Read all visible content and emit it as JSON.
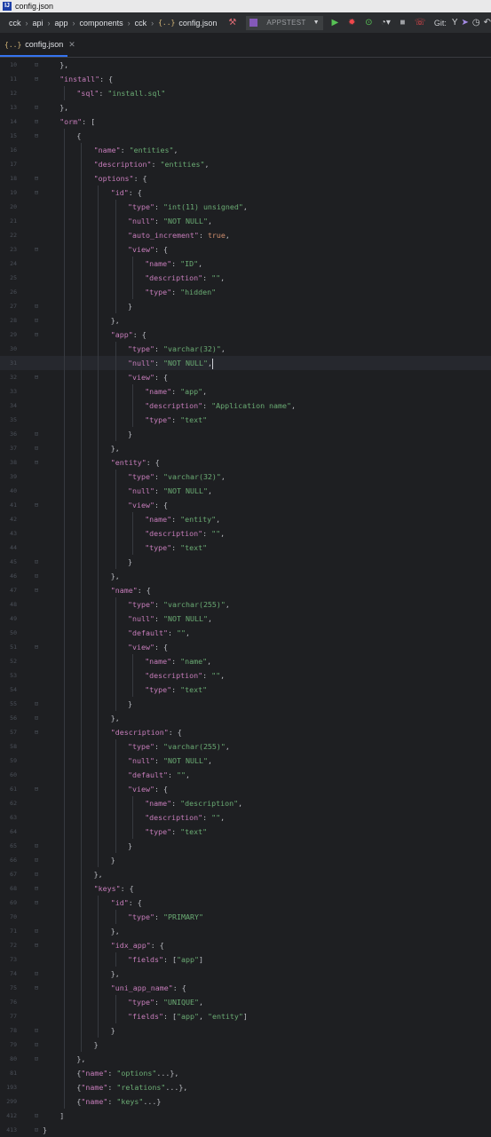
{
  "window": {
    "title": "config.json"
  },
  "navbar": {
    "breadcrumbs": [
      "cck",
      "api",
      "app",
      "components",
      "cck",
      "config.json"
    ],
    "run_config": "APPSTEST",
    "git_label": "Git:"
  },
  "tab": {
    "label": "config.json"
  },
  "colors": {
    "background": "#1e1f22",
    "key": "#c77dbb",
    "string": "#6aab73",
    "keyword": "#cf8e6d",
    "punct": "#bcbec4",
    "accent": "#3574f0"
  },
  "editor": {
    "current_line": 31,
    "lines": [
      {
        "n": "10",
        "indent": 1,
        "tokens": [
          [
            "p",
            "},"
          ]
        ]
      },
      {
        "n": "11",
        "indent": 1,
        "tokens": [
          [
            "k",
            "\"install\""
          ],
          [
            "p",
            ": {"
          ]
        ]
      },
      {
        "n": "12",
        "indent": 2,
        "tokens": [
          [
            "k",
            "\"sql\""
          ],
          [
            "p",
            ": "
          ],
          [
            "s",
            "\"install.sql\""
          ]
        ]
      },
      {
        "n": "13",
        "indent": 1,
        "tokens": [
          [
            "p",
            "},"
          ]
        ]
      },
      {
        "n": "14",
        "indent": 1,
        "tokens": [
          [
            "k",
            "\"orm\""
          ],
          [
            "p",
            ": ["
          ]
        ]
      },
      {
        "n": "15",
        "indent": 2,
        "tokens": [
          [
            "p",
            "{"
          ]
        ]
      },
      {
        "n": "16",
        "indent": 3,
        "tokens": [
          [
            "k",
            "\"name\""
          ],
          [
            "p",
            ": "
          ],
          [
            "s",
            "\"entities\""
          ],
          [
            "p",
            ","
          ]
        ]
      },
      {
        "n": "17",
        "indent": 3,
        "tokens": [
          [
            "k",
            "\"description\""
          ],
          [
            "p",
            ": "
          ],
          [
            "s",
            "\"entities\""
          ],
          [
            "p",
            ","
          ]
        ]
      },
      {
        "n": "18",
        "indent": 3,
        "tokens": [
          [
            "k",
            "\"options\""
          ],
          [
            "p",
            ": {"
          ]
        ]
      },
      {
        "n": "19",
        "indent": 4,
        "tokens": [
          [
            "k",
            "\"id\""
          ],
          [
            "p",
            ": {"
          ]
        ]
      },
      {
        "n": "20",
        "indent": 5,
        "tokens": [
          [
            "k",
            "\"type\""
          ],
          [
            "p",
            ": "
          ],
          [
            "s",
            "\"int(11) unsigned\""
          ],
          [
            "p",
            ","
          ]
        ]
      },
      {
        "n": "21",
        "indent": 5,
        "tokens": [
          [
            "k",
            "\"null\""
          ],
          [
            "p",
            ": "
          ],
          [
            "s",
            "\"NOT NULL\""
          ],
          [
            "p",
            ","
          ]
        ]
      },
      {
        "n": "22",
        "indent": 5,
        "tokens": [
          [
            "k",
            "\"auto_increment\""
          ],
          [
            "p",
            ": "
          ],
          [
            "w",
            "true"
          ],
          [
            "p",
            ","
          ]
        ]
      },
      {
        "n": "23",
        "indent": 5,
        "tokens": [
          [
            "k",
            "\"view\""
          ],
          [
            "p",
            ": {"
          ]
        ]
      },
      {
        "n": "24",
        "indent": 6,
        "tokens": [
          [
            "k",
            "\"name\""
          ],
          [
            "p",
            ": "
          ],
          [
            "s",
            "\"ID\""
          ],
          [
            "p",
            ","
          ]
        ]
      },
      {
        "n": "25",
        "indent": 6,
        "tokens": [
          [
            "k",
            "\"description\""
          ],
          [
            "p",
            ": "
          ],
          [
            "s",
            "\"\""
          ],
          [
            "p",
            ","
          ]
        ]
      },
      {
        "n": "26",
        "indent": 6,
        "tokens": [
          [
            "k",
            "\"type\""
          ],
          [
            "p",
            ": "
          ],
          [
            "s",
            "\"hidden\""
          ]
        ]
      },
      {
        "n": "27",
        "indent": 5,
        "tokens": [
          [
            "p",
            "}"
          ]
        ]
      },
      {
        "n": "28",
        "indent": 4,
        "tokens": [
          [
            "p",
            "},"
          ]
        ]
      },
      {
        "n": "29",
        "indent": 4,
        "tokens": [
          [
            "k",
            "\"app\""
          ],
          [
            "p",
            ": {"
          ]
        ]
      },
      {
        "n": "30",
        "indent": 5,
        "tokens": [
          [
            "k",
            "\"type\""
          ],
          [
            "p",
            ": "
          ],
          [
            "s",
            "\"varchar(32)\""
          ],
          [
            "p",
            ","
          ]
        ]
      },
      {
        "n": "31",
        "indent": 5,
        "tokens": [
          [
            "k",
            "\"null\""
          ],
          [
            "p",
            ": "
          ],
          [
            "s",
            "\"NOT NULL\""
          ],
          [
            "p",
            ","
          ]
        ]
      },
      {
        "n": "32",
        "indent": 5,
        "tokens": [
          [
            "k",
            "\"view\""
          ],
          [
            "p",
            ": {"
          ]
        ]
      },
      {
        "n": "33",
        "indent": 6,
        "tokens": [
          [
            "k",
            "\"name\""
          ],
          [
            "p",
            ": "
          ],
          [
            "s",
            "\"app\""
          ],
          [
            "p",
            ","
          ]
        ]
      },
      {
        "n": "34",
        "indent": 6,
        "tokens": [
          [
            "k",
            "\"description\""
          ],
          [
            "p",
            ": "
          ],
          [
            "s",
            "\"Application name\""
          ],
          [
            "p",
            ","
          ]
        ]
      },
      {
        "n": "35",
        "indent": 6,
        "tokens": [
          [
            "k",
            "\"type\""
          ],
          [
            "p",
            ": "
          ],
          [
            "s",
            "\"text\""
          ]
        ]
      },
      {
        "n": "36",
        "indent": 5,
        "tokens": [
          [
            "p",
            "}"
          ]
        ]
      },
      {
        "n": "37",
        "indent": 4,
        "tokens": [
          [
            "p",
            "},"
          ]
        ]
      },
      {
        "n": "38",
        "indent": 4,
        "tokens": [
          [
            "k",
            "\"entity\""
          ],
          [
            "p",
            ": {"
          ]
        ]
      },
      {
        "n": "39",
        "indent": 5,
        "tokens": [
          [
            "k",
            "\"type\""
          ],
          [
            "p",
            ": "
          ],
          [
            "s",
            "\"varchar(32)\""
          ],
          [
            "p",
            ","
          ]
        ]
      },
      {
        "n": "40",
        "indent": 5,
        "tokens": [
          [
            "k",
            "\"null\""
          ],
          [
            "p",
            ": "
          ],
          [
            "s",
            "\"NOT NULL\""
          ],
          [
            "p",
            ","
          ]
        ]
      },
      {
        "n": "41",
        "indent": 5,
        "tokens": [
          [
            "k",
            "\"view\""
          ],
          [
            "p",
            ": {"
          ]
        ]
      },
      {
        "n": "42",
        "indent": 6,
        "tokens": [
          [
            "k",
            "\"name\""
          ],
          [
            "p",
            ": "
          ],
          [
            "s",
            "\"entity\""
          ],
          [
            "p",
            ","
          ]
        ]
      },
      {
        "n": "43",
        "indent": 6,
        "tokens": [
          [
            "k",
            "\"description\""
          ],
          [
            "p",
            ": "
          ],
          [
            "s",
            "\"\""
          ],
          [
            "p",
            ","
          ]
        ]
      },
      {
        "n": "44",
        "indent": 6,
        "tokens": [
          [
            "k",
            "\"type\""
          ],
          [
            "p",
            ": "
          ],
          [
            "s",
            "\"text\""
          ]
        ]
      },
      {
        "n": "45",
        "indent": 5,
        "tokens": [
          [
            "p",
            "}"
          ]
        ]
      },
      {
        "n": "46",
        "indent": 4,
        "tokens": [
          [
            "p",
            "},"
          ]
        ]
      },
      {
        "n": "47",
        "indent": 4,
        "tokens": [
          [
            "k",
            "\"name\""
          ],
          [
            "p",
            ": {"
          ]
        ]
      },
      {
        "n": "48",
        "indent": 5,
        "tokens": [
          [
            "k",
            "\"type\""
          ],
          [
            "p",
            ": "
          ],
          [
            "s",
            "\"varchar(255)\""
          ],
          [
            "p",
            ","
          ]
        ]
      },
      {
        "n": "49",
        "indent": 5,
        "tokens": [
          [
            "k",
            "\"null\""
          ],
          [
            "p",
            ": "
          ],
          [
            "s",
            "\"NOT NULL\""
          ],
          [
            "p",
            ","
          ]
        ]
      },
      {
        "n": "50",
        "indent": 5,
        "tokens": [
          [
            "k",
            "\"default\""
          ],
          [
            "p",
            ": "
          ],
          [
            "s",
            "\"\""
          ],
          [
            "p",
            ","
          ]
        ]
      },
      {
        "n": "51",
        "indent": 5,
        "tokens": [
          [
            "k",
            "\"view\""
          ],
          [
            "p",
            ": {"
          ]
        ]
      },
      {
        "n": "52",
        "indent": 6,
        "tokens": [
          [
            "k",
            "\"name\""
          ],
          [
            "p",
            ": "
          ],
          [
            "s",
            "\"name\""
          ],
          [
            "p",
            ","
          ]
        ]
      },
      {
        "n": "53",
        "indent": 6,
        "tokens": [
          [
            "k",
            "\"description\""
          ],
          [
            "p",
            ": "
          ],
          [
            "s",
            "\"\""
          ],
          [
            "p",
            ","
          ]
        ]
      },
      {
        "n": "54",
        "indent": 6,
        "tokens": [
          [
            "k",
            "\"type\""
          ],
          [
            "p",
            ": "
          ],
          [
            "s",
            "\"text\""
          ]
        ]
      },
      {
        "n": "55",
        "indent": 5,
        "tokens": [
          [
            "p",
            "}"
          ]
        ]
      },
      {
        "n": "56",
        "indent": 4,
        "tokens": [
          [
            "p",
            "},"
          ]
        ]
      },
      {
        "n": "57",
        "indent": 4,
        "tokens": [
          [
            "k",
            "\"description\""
          ],
          [
            "p",
            ": {"
          ]
        ]
      },
      {
        "n": "58",
        "indent": 5,
        "tokens": [
          [
            "k",
            "\"type\""
          ],
          [
            "p",
            ": "
          ],
          [
            "s",
            "\"varchar(255)\""
          ],
          [
            "p",
            ","
          ]
        ]
      },
      {
        "n": "59",
        "indent": 5,
        "tokens": [
          [
            "k",
            "\"null\""
          ],
          [
            "p",
            ": "
          ],
          [
            "s",
            "\"NOT NULL\""
          ],
          [
            "p",
            ","
          ]
        ]
      },
      {
        "n": "60",
        "indent": 5,
        "tokens": [
          [
            "k",
            "\"default\""
          ],
          [
            "p",
            ": "
          ],
          [
            "s",
            "\"\""
          ],
          [
            "p",
            ","
          ]
        ]
      },
      {
        "n": "61",
        "indent": 5,
        "tokens": [
          [
            "k",
            "\"view\""
          ],
          [
            "p",
            ": {"
          ]
        ]
      },
      {
        "n": "62",
        "indent": 6,
        "tokens": [
          [
            "k",
            "\"name\""
          ],
          [
            "p",
            ": "
          ],
          [
            "s",
            "\"description\""
          ],
          [
            "p",
            ","
          ]
        ]
      },
      {
        "n": "63",
        "indent": 6,
        "tokens": [
          [
            "k",
            "\"description\""
          ],
          [
            "p",
            ": "
          ],
          [
            "s",
            "\"\""
          ],
          [
            "p",
            ","
          ]
        ]
      },
      {
        "n": "64",
        "indent": 6,
        "tokens": [
          [
            "k",
            "\"type\""
          ],
          [
            "p",
            ": "
          ],
          [
            "s",
            "\"text\""
          ]
        ]
      },
      {
        "n": "65",
        "indent": 5,
        "tokens": [
          [
            "p",
            "}"
          ]
        ]
      },
      {
        "n": "66",
        "indent": 4,
        "tokens": [
          [
            "p",
            "}"
          ]
        ]
      },
      {
        "n": "67",
        "indent": 3,
        "tokens": [
          [
            "p",
            "},"
          ]
        ]
      },
      {
        "n": "68",
        "indent": 3,
        "tokens": [
          [
            "k",
            "\"keys\""
          ],
          [
            "p",
            ": {"
          ]
        ]
      },
      {
        "n": "69",
        "indent": 4,
        "tokens": [
          [
            "k",
            "\"id\""
          ],
          [
            "p",
            ": {"
          ]
        ]
      },
      {
        "n": "70",
        "indent": 5,
        "tokens": [
          [
            "k",
            "\"type\""
          ],
          [
            "p",
            ": "
          ],
          [
            "s",
            "\"PRIMARY\""
          ]
        ]
      },
      {
        "n": "71",
        "indent": 4,
        "tokens": [
          [
            "p",
            "},"
          ]
        ]
      },
      {
        "n": "72",
        "indent": 4,
        "tokens": [
          [
            "k",
            "\"idx_app\""
          ],
          [
            "p",
            ": {"
          ]
        ]
      },
      {
        "n": "73",
        "indent": 5,
        "tokens": [
          [
            "k",
            "\"fields\""
          ],
          [
            "p",
            ": ["
          ],
          [
            "s",
            "\"app\""
          ],
          [
            "p",
            "]"
          ]
        ]
      },
      {
        "n": "74",
        "indent": 4,
        "tokens": [
          [
            "p",
            "},"
          ]
        ]
      },
      {
        "n": "75",
        "indent": 4,
        "tokens": [
          [
            "k",
            "\"uni_app_name\""
          ],
          [
            "p",
            ": {"
          ]
        ]
      },
      {
        "n": "76",
        "indent": 5,
        "tokens": [
          [
            "k",
            "\"type\""
          ],
          [
            "p",
            ": "
          ],
          [
            "s",
            "\"UNIQUE\""
          ],
          [
            "p",
            ","
          ]
        ]
      },
      {
        "n": "77",
        "indent": 5,
        "tokens": [
          [
            "k",
            "\"fields\""
          ],
          [
            "p",
            ": ["
          ],
          [
            "s",
            "\"app\""
          ],
          [
            "p",
            ", "
          ],
          [
            "s",
            "\"entity\""
          ],
          [
            "p",
            "]"
          ]
        ]
      },
      {
        "n": "78",
        "indent": 4,
        "tokens": [
          [
            "p",
            "}"
          ]
        ]
      },
      {
        "n": "79",
        "indent": 3,
        "tokens": [
          [
            "p",
            "}"
          ]
        ]
      },
      {
        "n": "80",
        "indent": 2,
        "tokens": [
          [
            "p",
            "},"
          ]
        ]
      },
      {
        "n": "81",
        "indent": 2,
        "tokens": [
          [
            "p",
            "{"
          ],
          [
            "k",
            "\"name\""
          ],
          [
            "p",
            ": "
          ],
          [
            "s",
            "\"options\""
          ],
          [
            "p",
            "...},"
          ]
        ]
      },
      {
        "n": "193",
        "indent": 2,
        "tokens": [
          [
            "p",
            "{"
          ],
          [
            "k",
            "\"name\""
          ],
          [
            "p",
            ": "
          ],
          [
            "s",
            "\"relations\""
          ],
          [
            "p",
            "...},"
          ]
        ]
      },
      {
        "n": "299",
        "indent": 2,
        "tokens": [
          [
            "p",
            "{"
          ],
          [
            "k",
            "\"name\""
          ],
          [
            "p",
            ": "
          ],
          [
            "s",
            "\"keys\""
          ],
          [
            "p",
            "...}"
          ]
        ]
      },
      {
        "n": "412",
        "indent": 1,
        "tokens": [
          [
            "p",
            "]"
          ]
        ]
      },
      {
        "n": "413",
        "indent": 0,
        "tokens": [
          [
            "p",
            "}"
          ]
        ]
      }
    ]
  }
}
